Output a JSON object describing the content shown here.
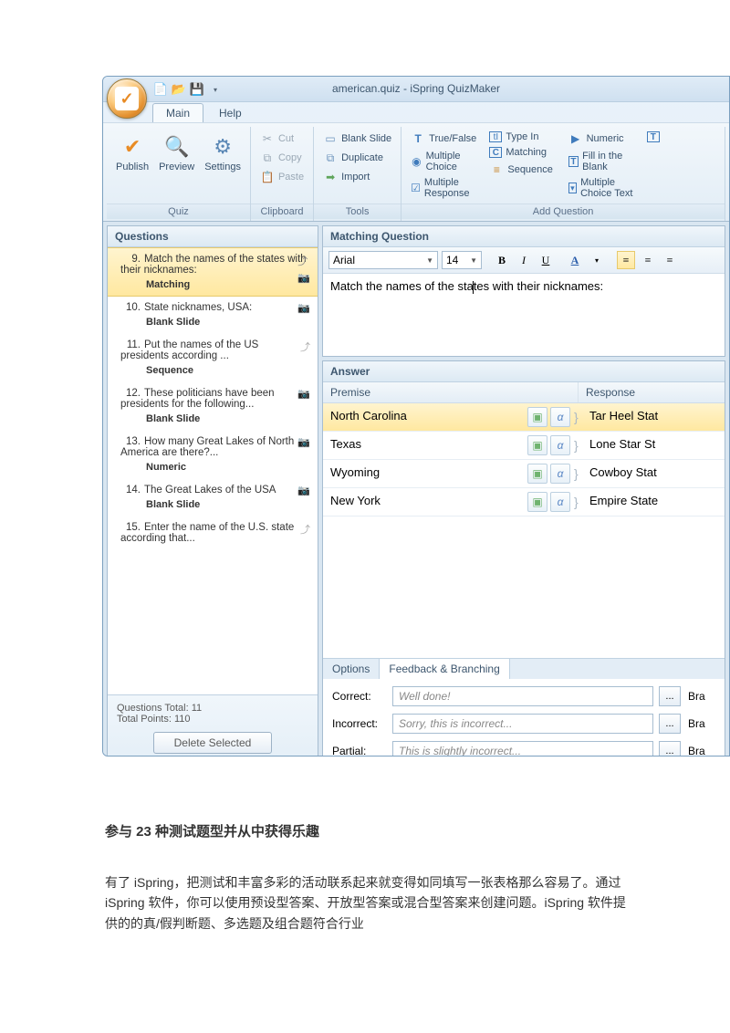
{
  "titlebar": {
    "title": "american.quiz - iSpring QuizMaker"
  },
  "tabs": {
    "main": "Main",
    "help": "Help"
  },
  "ribbon": {
    "quiz": {
      "label": "Quiz",
      "publish": "Publish",
      "preview": "Preview",
      "settings": "Settings"
    },
    "clipboard": {
      "label": "Clipboard",
      "cut": "Cut",
      "copy": "Copy",
      "paste": "Paste"
    },
    "tools": {
      "label": "Tools",
      "blank": "Blank Slide",
      "duplicate": "Duplicate",
      "import": "Import"
    },
    "addq": {
      "label": "Add Question",
      "truefalse": "True/False",
      "mchoice": "Multiple Choice",
      "mresponse": "Multiple Response",
      "typein": "Type In",
      "matching": "Matching",
      "sequence": "Sequence",
      "numeric": "Numeric",
      "fillblank": "Fill in the Blank",
      "mctext": "Multiple Choice Text"
    }
  },
  "questions": {
    "header": "Questions",
    "items": [
      {
        "num": "9.",
        "title": "Match the names of the states with their nicknames:",
        "type": "Matching",
        "sel": true
      },
      {
        "num": "10.",
        "title": "State nicknames, USA:",
        "type": "Blank Slide"
      },
      {
        "num": "11.",
        "title": "Put the names of the US presidents according ...",
        "type": "Sequence"
      },
      {
        "num": "12.",
        "title": "These politicians have been presidents for the following...",
        "type": "Blank Slide"
      },
      {
        "num": "13.",
        "title": "How many Great Lakes of North America are there?...",
        "type": "Numeric"
      },
      {
        "num": "14.",
        "title": "The Great Lakes of the USA",
        "type": "Blank Slide"
      },
      {
        "num": "15.",
        "title": "Enter the name of the U.S. state according that...",
        "type": ""
      }
    ],
    "total": "Questions Total: 11",
    "points": "Total Points: 110",
    "delete": "Delete Selected"
  },
  "editor": {
    "header": "Matching Question",
    "font": "Arial",
    "size": "14",
    "text_before": "Match the names of the sta",
    "text_after": "tes with their nicknames:"
  },
  "answer": {
    "header": "Answer",
    "premise_h": "Premise",
    "response_h": "Response",
    "rows": [
      {
        "p": "North Carolina",
        "r": "Tar Heel Stat",
        "sel": true
      },
      {
        "p": "Texas",
        "r": "Lone Star St"
      },
      {
        "p": "Wyoming",
        "r": "Cowboy Stat"
      },
      {
        "p": "New York",
        "r": "Empire State"
      }
    ]
  },
  "tabs2": {
    "options": "Options",
    "feedback": "Feedback & Branching"
  },
  "feedback": {
    "correct_l": "Correct:",
    "correct_v": "Well done!",
    "incorrect_l": "Incorrect:",
    "incorrect_v": "Sorry, this is incorrect...",
    "partial_l": "Partial:",
    "partial_v": "This is slightly incorrect...",
    "br": "Bra"
  },
  "doc": {
    "heading": "参与 23 种测试题型并从中获得乐趣",
    "p1": "有了 iSpring，把测试和丰富多彩的活动联系起来就变得如同填写一张表格那么容易了。通过 iSpring 软件，你可以使用预设型答案、开放型答案或混合型答案来创建问题。iSpring 软件提供的的真/假判断题、多选题及组合题符合行业"
  }
}
